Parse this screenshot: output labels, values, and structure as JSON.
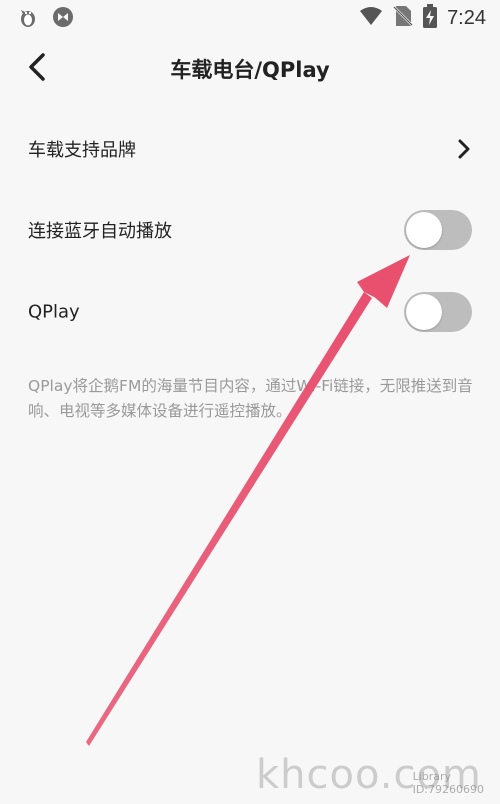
{
  "status_bar": {
    "time": "7:24",
    "icons": [
      "penguin-app-icon",
      "app-logo-icon",
      "wifi-icon",
      "no-sim-icon",
      "battery-charging-icon"
    ]
  },
  "header": {
    "title": "车载电台/QPlay",
    "back_icon": "chevron-left-icon"
  },
  "settings": {
    "brands_label": "车载支持品牌",
    "bluetooth_autoplay_label": "连接蓝牙自动播放",
    "bluetooth_autoplay_on": false,
    "qplay_label": "QPlay",
    "qplay_on": false
  },
  "description": "QPlay将企鹅FM的海量节目内容，通过Wi-Fi链接，无限推送到音响、电视等多媒体设备进行遥控播放。",
  "annotation": {
    "arrow_color": "#e8506e"
  },
  "watermark": {
    "site": "khcoo.com",
    "library_label": "Library",
    "id_label": "ID:79260690"
  }
}
